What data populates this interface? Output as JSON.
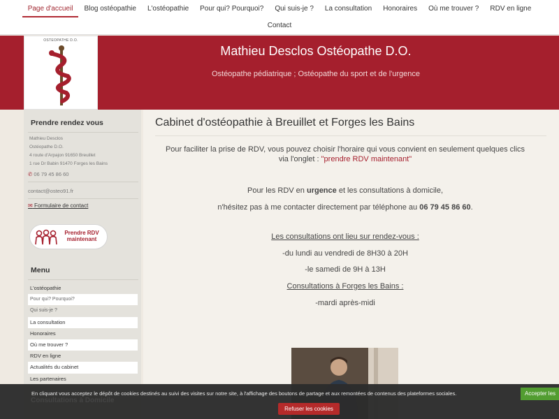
{
  "nav": {
    "row1": [
      {
        "label": "Page d'accueil",
        "active": true
      },
      {
        "label": "Blog ostéopathie"
      },
      {
        "label": "L'ostéopathie"
      },
      {
        "label": "Pour qui? Pourquoi?"
      },
      {
        "label": "Qui suis-je ?"
      },
      {
        "label": "La consultation"
      },
      {
        "label": "Honoraires"
      },
      {
        "label": "Où me trouver ?"
      },
      {
        "label": "RDV en ligne"
      }
    ],
    "row2": [
      {
        "label": "Contact"
      }
    ]
  },
  "banner": {
    "logo_text": "OSTEOPATHE D.O.",
    "title": "Mathieu Desclos Ostéopathe D.O.",
    "subtitle": "Ostéopathe pédiatrique ; Ostéopathe du sport et de l'urgence"
  },
  "sidebar": {
    "rdv_heading": "Prendre rendez vous",
    "address_lines": [
      "Mathieu Desclos",
      "Ostéopathe D.O.",
      "4 route d'Arpajon 91650 Breuillet",
      "1 rue Dr Babin 91470 Forges les Bains"
    ],
    "phone": "06 79 45 86 60",
    "email": "contact@osteo91.fr",
    "contact_form": "Formulaire de contact",
    "rdv_button": "Prendre RDV maintenant",
    "menu_heading": "Menu",
    "menu": [
      "L'ostéopathie",
      "Pour qui? Pourquoi?",
      "Qui suis-je ?",
      "La consultation",
      "Honoraires",
      "Où me trouver ?",
      "RDV en ligne",
      "Actualités du cabinet",
      "Les partenaires"
    ]
  },
  "main": {
    "title": "Cabinet d'ostéopathie à Breuillet et Forges les Bains",
    "p1_pre": "Pour faciliter la prise de RDV, vous pouvez choisir l'horaire qui vous convient en seulement quelques clics via l'onglet : ",
    "p1_link": "\"prendre RDV maintenant\"",
    "p2_pre": "Pour les RDV en ",
    "p2_bold": "urgence",
    "p2_post": " et les consultations à domicile,",
    "p3_pre": "n'hésitez pas à me contacter directement par téléphone au ",
    "p3_bold": "06 79 45 86 60",
    "p3_post": ".",
    "hours_heading": "Les consultations ont lieu sur rendez-vous :",
    "hours_week": "-du lundi au vendredi de 8H30 à 20H",
    "hours_sat": "-le samedi de 9H à 13H",
    "forges_heading": "Consultations à Forges les Bains :",
    "forges_day": "-mardi après-midi"
  },
  "cookie": {
    "text": "En cliquant vous acceptez le dépôt de cookies destinés au suivi des visites sur notre site, à l'affichage des boutons de partage et aux remontées de contenus des plateformes sociales.",
    "accept": "Accepter les",
    "refuse": "Refuser les cookies",
    "under": "Consultations à Domicile"
  },
  "colors": {
    "brand": "#a51f2d",
    "accept": "#4c9a2a",
    "refuse": "#b52a2a"
  }
}
